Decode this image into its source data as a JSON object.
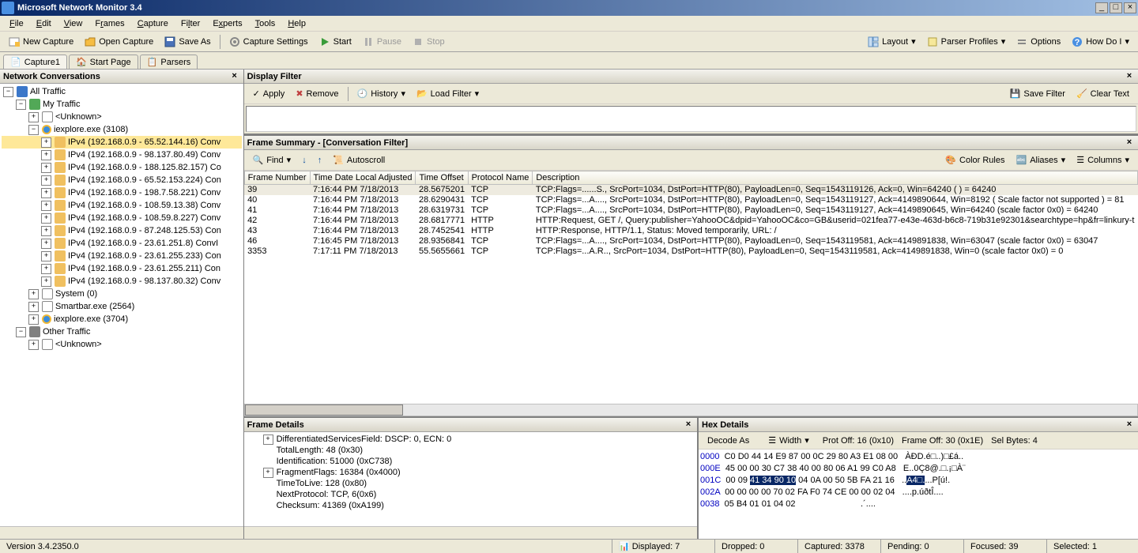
{
  "title": "Microsoft Network Monitor 3.4",
  "menu": [
    "File",
    "Edit",
    "View",
    "Frames",
    "Capture",
    "Filter",
    "Experts",
    "Tools",
    "Help"
  ],
  "toolbar1": {
    "newCapture": "New Capture",
    "openCapture": "Open Capture",
    "saveAs": "Save As",
    "captureSettings": "Capture Settings",
    "start": "Start",
    "pause": "Pause",
    "stop": "Stop",
    "layout": "Layout",
    "parserProfiles": "Parser Profiles",
    "options": "Options",
    "howDoI": "How Do I"
  },
  "tabs": {
    "capture": "Capture1",
    "startPage": "Start Page",
    "parsers": "Parsers"
  },
  "leftPanel": {
    "title": "Network Conversations"
  },
  "tree": {
    "allTraffic": "All Traffic",
    "myTraffic": "My Traffic",
    "unknown": "<Unknown>",
    "iexplore1": "iexplore.exe (3108)",
    "conv": [
      "IPv4 (192.168.0.9 - 65.52.144.16) Conv",
      "IPv4 (192.168.0.9 - 98.137.80.49) Conv",
      "IPv4 (192.168.0.9 - 188.125.82.157) Co",
      "IPv4 (192.168.0.9 - 65.52.153.224) Con",
      "IPv4 (192.168.0.9 - 198.7.58.221) Conv",
      "IPv4 (192.168.0.9 - 108.59.13.38) Conv",
      "IPv4 (192.168.0.9 - 108.59.8.227) Conv",
      "IPv4 (192.168.0.9 - 87.248.125.53) Con",
      "IPv4 (192.168.0.9 - 23.61.251.8) ConvI",
      "IPv4 (192.168.0.9 - 23.61.255.233) Con",
      "IPv4 (192.168.0.9 - 23.61.255.211) Con",
      "IPv4 (192.168.0.9 - 98.137.80.32) Conv"
    ],
    "system": "System (0)",
    "smartbar": "Smartbar.exe (2564)",
    "iexplore2": "iexplore.exe (3704)",
    "otherTraffic": "Other Traffic",
    "unknown2": "<Unknown>"
  },
  "displayFilter": {
    "title": "Display Filter",
    "apply": "Apply",
    "remove": "Remove",
    "history": "History",
    "loadFilter": "Load Filter",
    "saveFilter": "Save Filter",
    "clearText": "Clear Text"
  },
  "frameSummary": {
    "title": "Frame Summary - [Conversation Filter]",
    "find": "Find",
    "autoscroll": "Autoscroll",
    "colorRules": "Color Rules",
    "aliases": "Aliases",
    "columns": "Columns",
    "headers": [
      "Frame Number",
      "Time Date Local Adjusted",
      "Time Offset",
      "Protocol Name",
      "Description"
    ],
    "rows": [
      [
        "39",
        "7:16:44 PM 7/18/2013",
        "28.5675201",
        "TCP",
        "TCP:Flags=......S., SrcPort=1034, DstPort=HTTP(80), PayloadLen=0, Seq=1543119126, Ack=0, Win=64240 (  ) = 64240"
      ],
      [
        "40",
        "7:16:44 PM 7/18/2013",
        "28.6290431",
        "TCP",
        "TCP:Flags=...A...., SrcPort=1034, DstPort=HTTP(80), PayloadLen=0, Seq=1543119127, Ack=4149890644, Win=8192 ( Scale factor not supported ) = 81"
      ],
      [
        "41",
        "7:16:44 PM 7/18/2013",
        "28.6319731",
        "TCP",
        "TCP:Flags=...A...., SrcPort=1034, DstPort=HTTP(80), PayloadLen=0, Seq=1543119127, Ack=4149890645, Win=64240 (scale factor 0x0) = 64240"
      ],
      [
        "42",
        "7:16:44 PM 7/18/2013",
        "28.6817771",
        "HTTP",
        "HTTP:Request, GET /, Query:publisher=YahooOC&dpid=YahooOC&co=GB&userid=021fea77-e43e-463d-b6c8-719b31e92301&searchtype=hp&fr=linkury-t"
      ],
      [
        "43",
        "7:16:44 PM 7/18/2013",
        "28.7452541",
        "HTTP",
        "HTTP:Response, HTTP/1.1, Status: Moved temporarily, URL: /"
      ],
      [
        "46",
        "7:16:45 PM 7/18/2013",
        "28.9356841",
        "TCP",
        "TCP:Flags=...A...., SrcPort=1034, DstPort=HTTP(80), PayloadLen=0, Seq=1543119581, Ack=4149891838, Win=63047 (scale factor 0x0) = 63047"
      ],
      [
        "3353",
        "7:17:11 PM 7/18/2013",
        "55.5655661",
        "TCP",
        "TCP:Flags=...A.R.., SrcPort=1034, DstPort=HTTP(80), PayloadLen=0, Seq=1543119581, Ack=4149891838, Win=0 (scale factor 0x0) = 0"
      ]
    ]
  },
  "frameDetails": {
    "title": "Frame Details",
    "lines": [
      {
        "t": "+",
        "text": "DifferentiatedServicesField: DSCP: 0, ECN: 0"
      },
      {
        "t": " ",
        "text": "TotalLength: 48 (0x30)"
      },
      {
        "t": " ",
        "text": "Identification: 51000 (0xC738)"
      },
      {
        "t": "+",
        "text": "FragmentFlags: 16384 (0x4000)"
      },
      {
        "t": " ",
        "text": "TimeToLive: 128 (0x80)"
      },
      {
        "t": " ",
        "text": "NextProtocol: TCP, 6(0x6)"
      },
      {
        "t": " ",
        "text": "Checksum: 41369 (0xA199)"
      }
    ]
  },
  "hexDetails": {
    "title": "Hex Details",
    "decodeAs": "Decode As",
    "width": "Width",
    "protOff": "Prot Off: 16 (0x10)",
    "frameOff": "Frame Off: 30 (0x1E)",
    "selBytes": "Sel Bytes: 4",
    "rows": [
      {
        "off": "0000",
        "hex": "C0 D0 44 14 E9 87 00 0C 29 80 A3 E1 08 00",
        "asc": "ÀÐD.é□..)□£á.."
      },
      {
        "off": "000E",
        "hex": "45 00 00 30 C7 38 40 00 80 06 A1 99 C0 A8",
        "asc": "E..0Ç8@.□.¡□À¨"
      },
      {
        "off": "001C",
        "p1": "00 09 ",
        "hl": "41 34 90 10",
        "p2": " 04 0A 00 50 5B FA 21 16",
        "asc1": "..",
        "aschl": "A4□.",
        "asc2": "...P[ú!."
      },
      {
        "off": "002A",
        "hex": "00 00 00 00 70 02 FA F0 74 CE 00 00 02 04",
        "asc": "....p.úðtÎ...."
      },
      {
        "off": "0038",
        "hex": "05 B4 01 01 04 02",
        "asc": ".´...."
      }
    ]
  },
  "status": {
    "version": "Version 3.4.2350.0",
    "displayed": "Displayed: 7",
    "dropped": "Dropped: 0",
    "captured": "Captured: 3378",
    "pending": "Pending: 0",
    "focused": "Focused: 39",
    "selected": "Selected: 1"
  }
}
